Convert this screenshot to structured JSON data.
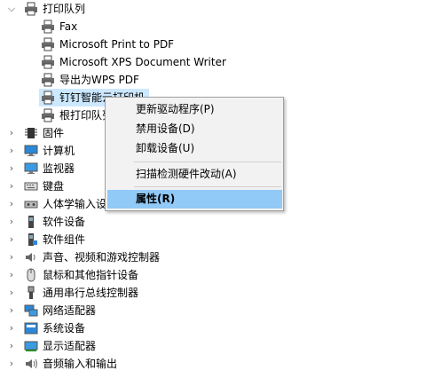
{
  "tree": {
    "parent": {
      "label": "打印队列",
      "icon": "printer-icon",
      "expanded": true
    },
    "children": [
      {
        "label": "Fax",
        "icon": "printer-icon"
      },
      {
        "label": "Microsoft Print to PDF",
        "icon": "printer-icon"
      },
      {
        "label": "Microsoft XPS Document Writer",
        "icon": "printer-icon"
      },
      {
        "label": "导出为WPS PDF",
        "icon": "printer-icon"
      },
      {
        "label": "钉钉智能云打印机",
        "icon": "printer-icon",
        "selected": true
      },
      {
        "label": "根打印队列",
        "icon": "printer-icon"
      }
    ],
    "categories": [
      {
        "label": "固件",
        "icon": "firmware-chip-icon"
      },
      {
        "label": "计算机",
        "icon": "computer-monitor-icon"
      },
      {
        "label": "监视器",
        "icon": "monitor-icon"
      },
      {
        "label": "键盘",
        "icon": "keyboard-icon"
      },
      {
        "label": "人体学输入设备",
        "icon": "hid-device-icon"
      },
      {
        "label": "软件设备",
        "icon": "software-device-icon"
      },
      {
        "label": "软件组件",
        "icon": "software-component-icon"
      },
      {
        "label": "声音、视频和游戏控制器",
        "icon": "speaker-icon"
      },
      {
        "label": "鼠标和其他指针设备",
        "icon": "mouse-icon"
      },
      {
        "label": "通用串行总线控制器",
        "icon": "usb-icon"
      },
      {
        "label": "网络适配器",
        "icon": "network-adapter-icon"
      },
      {
        "label": "系统设备",
        "icon": "system-device-icon"
      },
      {
        "label": "显示适配器",
        "icon": "display-adapter-icon"
      },
      {
        "label": "音频输入和输出",
        "icon": "audio-io-icon"
      }
    ]
  },
  "context_menu": {
    "update_driver": "更新驱动程序(P)",
    "disable_device": "禁用设备(D)",
    "uninstall_device": "卸载设备(U)",
    "scan_hardware": "扫描检测硬件改动(A)",
    "properties": "属性(R)"
  },
  "colors": {
    "selection": "#cce8ff",
    "menu_highlight": "#91c9f7",
    "menu_background": "#f2f2f2"
  }
}
